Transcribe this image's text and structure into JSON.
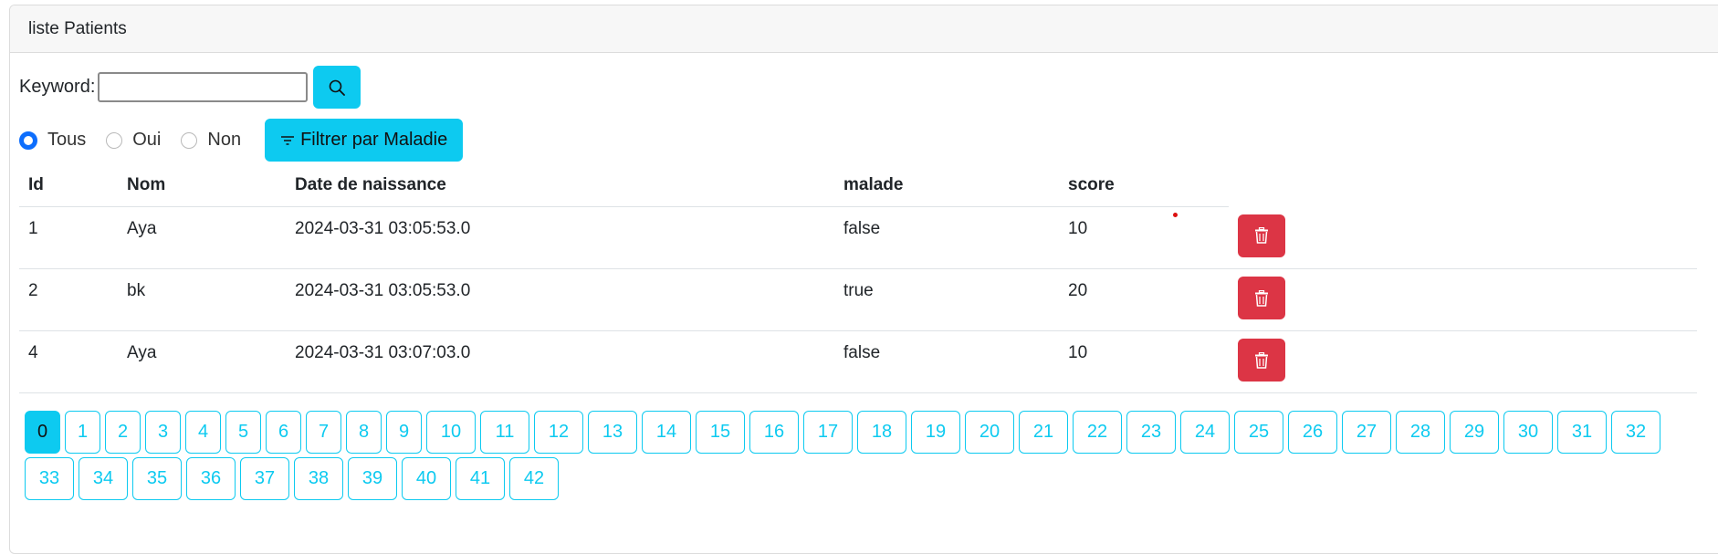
{
  "card": {
    "title": "liste Patients"
  },
  "search": {
    "label": "Keyword:",
    "value": "",
    "placeholder": "",
    "button_icon": "search-icon"
  },
  "filter": {
    "options": [
      {
        "label": "Tous",
        "checked": true
      },
      {
        "label": "Oui",
        "checked": false
      },
      {
        "label": "Non",
        "checked": false
      }
    ],
    "button_label": "Filtrer par Maladie",
    "button_icon": "filter-icon"
  },
  "table": {
    "headers": [
      "Id",
      "Nom",
      "Date de naissance",
      "malade",
      "score"
    ],
    "rows": [
      {
        "id": "1",
        "nom": "Aya",
        "date": "2024-03-31 03:05:53.0",
        "malade": "false",
        "score": "10"
      },
      {
        "id": "2",
        "nom": "bk",
        "date": "2024-03-31 03:05:53.0",
        "malade": "true",
        "score": "20"
      },
      {
        "id": "4",
        "nom": "Aya",
        "date": "2024-03-31 03:07:03.0",
        "malade": "false",
        "score": "10"
      }
    ],
    "delete_icon": "trash-icon"
  },
  "pagination": {
    "current": "0",
    "pages": [
      "0",
      "1",
      "2",
      "3",
      "4",
      "5",
      "6",
      "7",
      "8",
      "9",
      "10",
      "11",
      "12",
      "13",
      "14",
      "15",
      "16",
      "17",
      "18",
      "19",
      "20",
      "21",
      "22",
      "23",
      "24",
      "25",
      "26",
      "27",
      "28",
      "29",
      "30",
      "31",
      "32",
      "33",
      "34",
      "35",
      "36",
      "37",
      "38",
      "39",
      "40",
      "41",
      "42"
    ]
  },
  "colors": {
    "info": "#0dcaf0",
    "danger": "#dc3545",
    "primary": "#0d6efd"
  }
}
